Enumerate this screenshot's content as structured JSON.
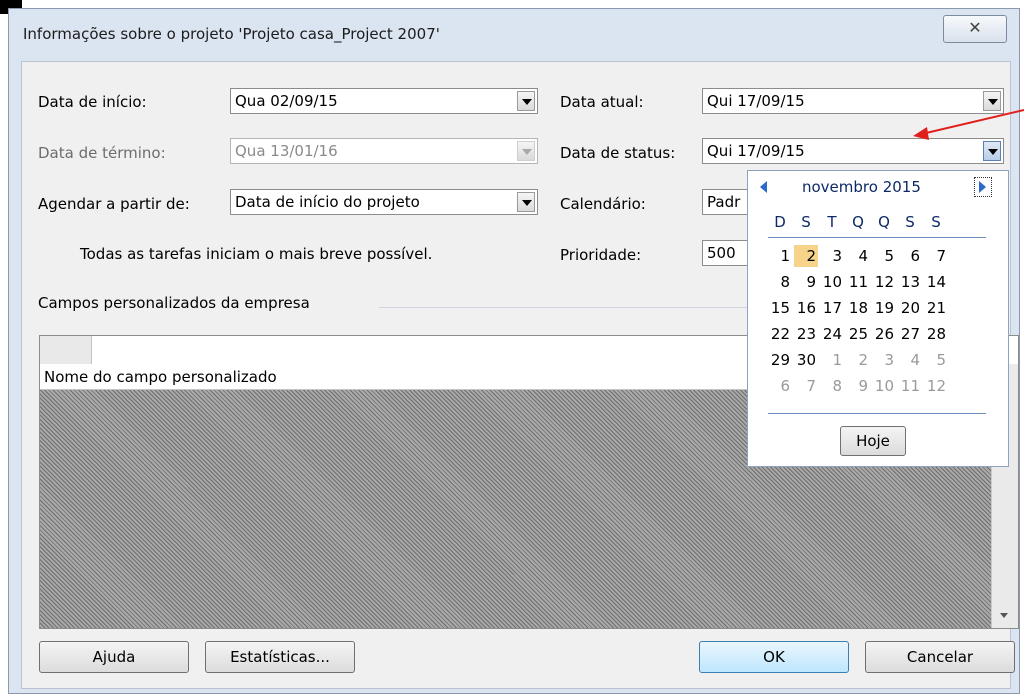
{
  "window": {
    "title": "Informações sobre o projeto 'Projeto casa_Project 2007'",
    "close_glyph": "✕"
  },
  "fields": {
    "start_date": {
      "label": "Data de início:",
      "value": "Qua 02/09/15"
    },
    "finish_date": {
      "label": "Data de término:",
      "value": "Qua 13/01/16"
    },
    "schedule_from": {
      "label": "Agendar a partir de:",
      "value": "Data de início do projeto"
    },
    "schedule_note": "Todas as tarefas iniciam o mais breve possível.",
    "current_date": {
      "label": "Data atual:",
      "value": "Qui 17/09/15"
    },
    "status_date": {
      "label": "Data de status:",
      "value": "Qui 17/09/15"
    },
    "calendar": {
      "label": "Calendário:",
      "value": "Padr"
    },
    "priority": {
      "label": "Prioridade:",
      "value": "500"
    }
  },
  "custom_fields": {
    "group_label": "Campos personalizados da empresa",
    "column_header": "Nome do campo personalizado"
  },
  "buttons": {
    "help": "Ajuda",
    "statistics": "Estatísticas...",
    "ok": "OK",
    "cancel": "Cancelar"
  },
  "datepicker": {
    "month": "novembro 2015",
    "day_headers": [
      "D",
      "S",
      "T",
      "Q",
      "Q",
      "S",
      "S"
    ],
    "weeks": [
      [
        "1",
        "2",
        "3",
        "4",
        "5",
        "6",
        "7"
      ],
      [
        "8",
        "9",
        "10",
        "11",
        "12",
        "13",
        "14"
      ],
      [
        "15",
        "16",
        "17",
        "18",
        "19",
        "20",
        "21"
      ],
      [
        "22",
        "23",
        "24",
        "25",
        "26",
        "27",
        "28"
      ],
      [
        "29",
        "30",
        "1",
        "2",
        "3",
        "4",
        "5"
      ],
      [
        "6",
        "7",
        "8",
        "9",
        "10",
        "11",
        "12"
      ]
    ],
    "today_button": "Hoje"
  },
  "colors": {
    "annotation_arrow": "#e0201c",
    "highlight_day": "#f6d58a"
  }
}
